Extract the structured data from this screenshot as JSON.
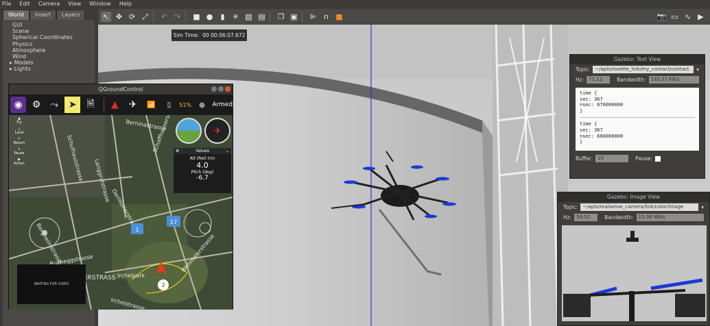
{
  "menu": [
    "File",
    "Edit",
    "Camera",
    "View",
    "Window",
    "Help"
  ],
  "left_panel": {
    "tabs": [
      "World",
      "Insert",
      "Layers"
    ],
    "tree": [
      "GUI",
      "Scene",
      "Spherical Coordinates",
      "Physics",
      "Atmosphere",
      "Wind"
    ],
    "expandable": [
      "Models",
      "Lights"
    ]
  },
  "sim_time": {
    "label": "Sim Time:",
    "value": "00 00:06:07.672"
  },
  "qgc": {
    "title": "QGroundControl",
    "status": {
      "battery": "51%",
      "mode": "Armed"
    },
    "side_buttons": [
      "Fly",
      "Land",
      "Return",
      "Pause",
      "Action"
    ],
    "values_widget": {
      "header": "Values",
      "alt_label": "Alt (Rel) (m)",
      "alt_value": "4.0",
      "pitch_label": "Pitch (deg)",
      "pitch_value": "-6.7"
    },
    "map_labels": [
      "Berninastrasse",
      "Schaffhauserstrasse",
      "Buchegg platz",
      "Hofwiesenstrasse",
      "Oerlikonerstrasse",
      "Wehntalerstrasse",
      "Schulhausstrasse",
      "Langgrutstrasse",
      "Bucheggstrasse",
      "Irchelpark",
      "Irchelstrasse",
      "UNTERSTRASS",
      "Bergheimstrasse",
      "Stampfenbachstrasse",
      "Beckenhof"
    ],
    "map_markers": [
      "1",
      "17",
      "2"
    ],
    "video_text": "WAITING FOR VIDEO"
  },
  "text_view": {
    "title": "Gazebo: Text View",
    "topic_label": "Topic:",
    "topic_value": "~/apis/rosette_link/my_contact/contact",
    "hz_label": "Hz:",
    "hz_value": "71.12",
    "bw_label": "Bandwidth:",
    "bw_value": "193.57 KB/s",
    "messages": [
      "time {",
      "  sec: 367",
      "  nsec: 676000000",
      "}",
      "time {",
      "  sec: 367",
      "  nsec: 680000000",
      "}"
    ],
    "buffer_label": "Buffer:",
    "buffer_value": "10",
    "pause_label": "Pause:"
  },
  "image_view": {
    "title": "Gazebo: Image View",
    "topic_label": "Topic:",
    "topic_value": "~/apis/realsense_camera/link/color/image",
    "hz_label": "Hz:",
    "hz_value": "59.52",
    "bw_label": "Bandwidth:",
    "bw_value": "15.36 MB/s"
  }
}
